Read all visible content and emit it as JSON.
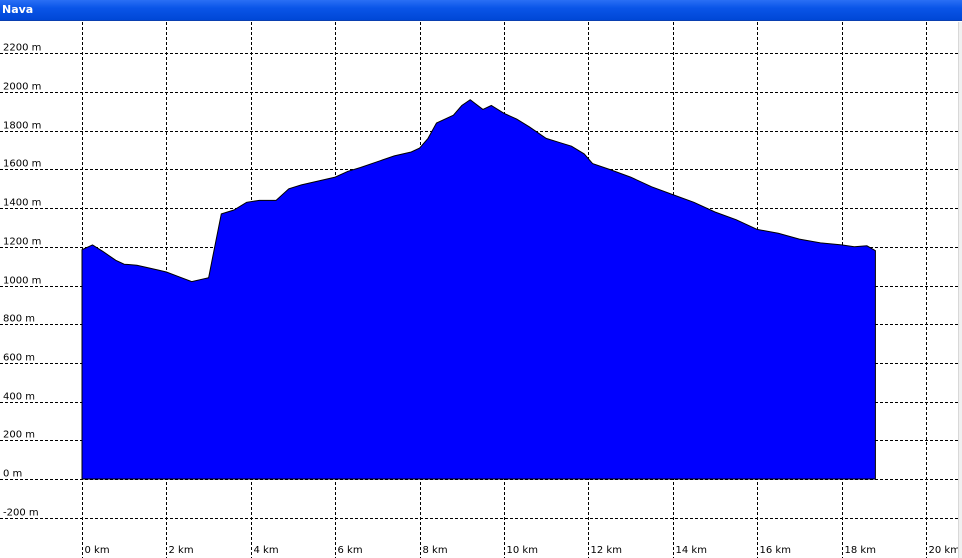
{
  "window": {
    "title": "Nava"
  },
  "colors": {
    "fill": "#0000ff",
    "outline": "#000000",
    "grid": "#000000",
    "title_bar": "#0054e3"
  },
  "chart_data": {
    "type": "area",
    "title": "",
    "xlabel": "",
    "ylabel": "",
    "xlim": [
      -1,
      20.7
    ],
    "ylim": [
      -300,
      2330
    ],
    "grid": true,
    "legend": "none",
    "x_ticks": [
      {
        "value": 0,
        "label": "0 km"
      },
      {
        "value": 2,
        "label": "2 km"
      },
      {
        "value": 4,
        "label": "4 km"
      },
      {
        "value": 6,
        "label": "6 km"
      },
      {
        "value": 8,
        "label": "8 km"
      },
      {
        "value": 10,
        "label": "10 km"
      },
      {
        "value": 12,
        "label": "12 km"
      },
      {
        "value": 14,
        "label": "14 km"
      },
      {
        "value": 16,
        "label": "16 km"
      },
      {
        "value": 18,
        "label": "18 km"
      },
      {
        "value": 20,
        "label": "20 km"
      }
    ],
    "y_ticks": [
      {
        "value": -200,
        "label": "-200 m"
      },
      {
        "value": 0,
        "label": "0 m"
      },
      {
        "value": 200,
        "label": "200 m"
      },
      {
        "value": 400,
        "label": "400 m"
      },
      {
        "value": 600,
        "label": "600 m"
      },
      {
        "value": 800,
        "label": "800 m"
      },
      {
        "value": 1000,
        "label": "1000 m"
      },
      {
        "value": 1200,
        "label": "1200 m"
      },
      {
        "value": 1400,
        "label": "1400 m"
      },
      {
        "value": 1600,
        "label": "1600 m"
      },
      {
        "value": 1800,
        "label": "1800 m"
      },
      {
        "value": 2000,
        "label": "2000 m"
      },
      {
        "value": 2200,
        "label": "2200 m"
      }
    ],
    "series": [
      {
        "x": [
          0,
          0.25,
          0.5,
          0.8,
          1.0,
          1.3,
          1.5,
          1.8,
          2.0,
          2.3,
          2.6,
          2.9,
          3.0,
          3.1,
          3.3,
          3.6,
          3.9,
          4.2,
          4.6,
          4.9,
          5.2,
          5.6,
          6.0,
          6.3,
          6.6,
          7.0,
          7.4,
          7.8,
          8.0,
          8.2,
          8.4,
          8.8,
          9.0,
          9.2,
          9.5,
          9.7,
          10.0,
          10.3,
          10.6,
          11.0,
          11.3,
          11.6,
          11.9,
          12.1,
          12.5,
          13.0,
          13.5,
          14.0,
          14.5,
          15.0,
          15.5,
          16.0,
          16.5,
          17.0,
          17.5,
          18.0,
          18.3,
          18.6,
          18.8
        ],
        "y": [
          1185,
          1210,
          1175,
          1130,
          1110,
          1105,
          1095,
          1080,
          1070,
          1045,
          1020,
          1035,
          1040,
          1150,
          1370,
          1390,
          1430,
          1440,
          1440,
          1500,
          1520,
          1540,
          1560,
          1590,
          1610,
          1640,
          1670,
          1690,
          1710,
          1760,
          1840,
          1880,
          1930,
          1960,
          1910,
          1930,
          1890,
          1860,
          1820,
          1760,
          1740,
          1720,
          1680,
          1630,
          1600,
          1560,
          1510,
          1470,
          1430,
          1380,
          1340,
          1290,
          1270,
          1240,
          1220,
          1210,
          1200,
          1205,
          1180
        ]
      }
    ]
  }
}
